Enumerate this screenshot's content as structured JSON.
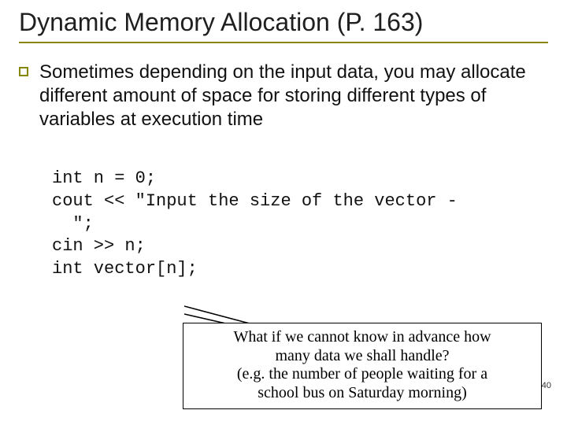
{
  "title": "Dynamic Memory Allocation (P. 163)",
  "bullet": "Sometimes depending on the input data, you may allocate different amount of space for storing different types of variables at execution time",
  "code": {
    "l1": "int n = 0;",
    "l2": "cout << \"Input the size of the vector -",
    "l3": "  \";",
    "l4": "cin >> n;",
    "l5": "int vector[n];"
  },
  "callout": {
    "l1": "What if we cannot know in advance how",
    "l2": "many data we shall handle?",
    "l3": "(e.g. the number of people waiting for a",
    "l4": "school bus on Saturday morning)"
  },
  "page_number": "40"
}
